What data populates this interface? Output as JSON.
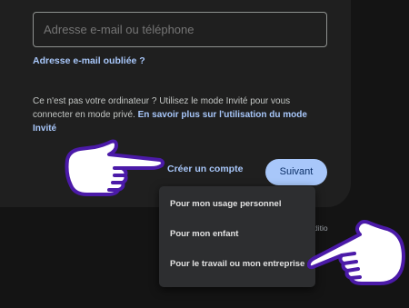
{
  "login": {
    "email_placeholder": "Adresse e-mail ou téléphone",
    "forgot_email": "Adresse e-mail oubliée ?",
    "guest_text": "Ce n'est pas votre ordinateur ? Utilisez le mode Invité pour vous connecter en mode privé.",
    "guest_learn_more": "En savoir plus sur l'utilisation du mode Invité",
    "create_account": "Créer un compte",
    "next": "Suivant"
  },
  "account_menu": {
    "items": [
      {
        "label": "Pour mon usage personnel"
      },
      {
        "label": "Pour mon enfant"
      },
      {
        "label": "Pour le travail ou mon entreprise"
      }
    ]
  },
  "footer": {
    "partial_text": "ditio"
  },
  "colors": {
    "page_bg": "#141414",
    "card_bg": "#1f1f1f",
    "link": "#a8c7fa",
    "primary_button": "#a8c7fa",
    "menu_bg": "#2d2e30",
    "pointer_outline": "#4b1aa8"
  },
  "icons": [
    "pointing-hand-icon",
    "pointing-hand-icon"
  ]
}
